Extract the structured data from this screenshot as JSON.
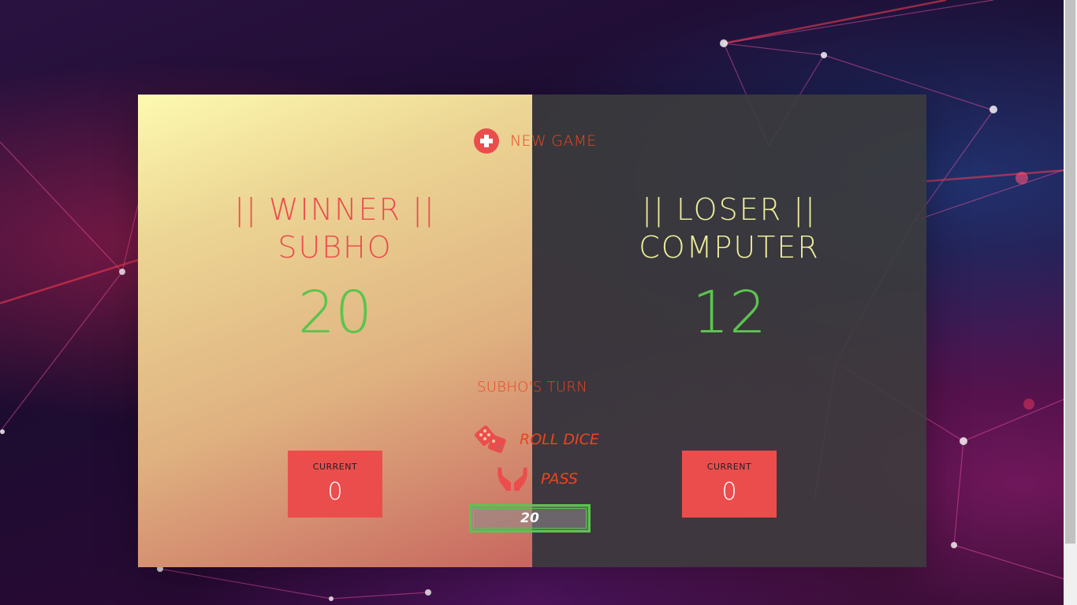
{
  "game": {
    "new_game_label": "NEW GAME",
    "turn_text": "SUBHO'S TURN",
    "roll_dice_label": "ROLL DICE",
    "pass_label": "PASS",
    "final_score_value": "20",
    "icons": {
      "new_game": "plus-circle-icon",
      "roll_dice": "dice-icon",
      "pass": "hands-icon"
    }
  },
  "players": [
    {
      "name_line1": "|| WINNER ||",
      "name_line2": "SUBHO",
      "score": "20",
      "current_label": "CURRENT",
      "current_score": "0"
    },
    {
      "name_line1": "|| LOSER ||",
      "name_line2": "COMPUTER",
      "score": "12",
      "current_label": "CURRENT",
      "current_score": "0"
    }
  ],
  "colors": {
    "accent_red": "#eb4d4d",
    "text_orange": "#e8461e",
    "score_green": "#5bc44e",
    "loser_text": "#efee9c",
    "dark_panel": "#3c3c3c"
  }
}
